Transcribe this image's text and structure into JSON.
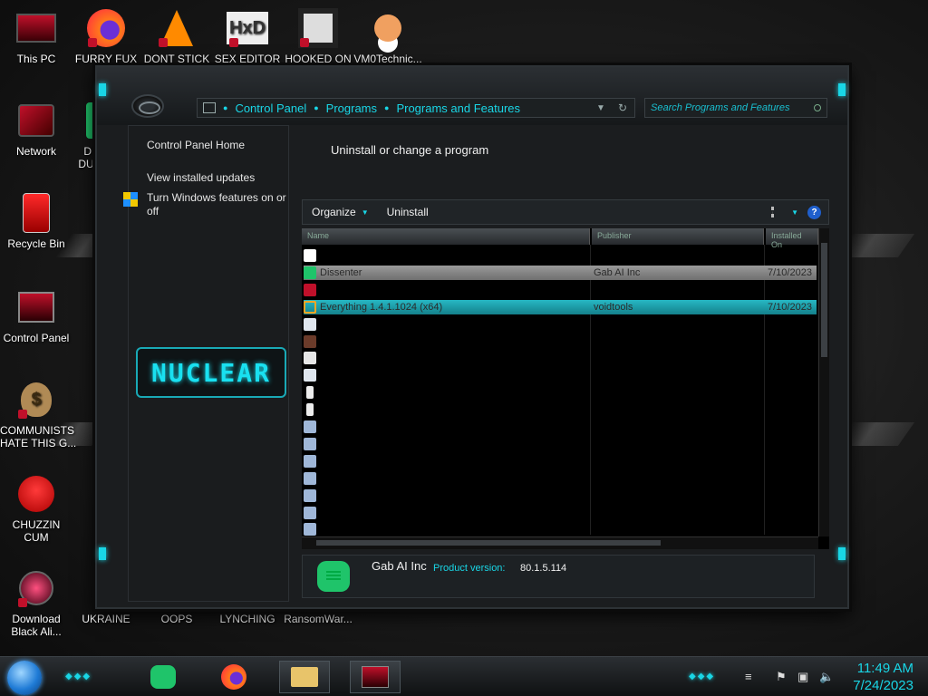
{
  "desktop": {
    "icons": [
      {
        "label": "This PC"
      },
      {
        "label": "FURRY FUX"
      },
      {
        "label": "DONT STICK"
      },
      {
        "label": "SEX EDITOR"
      },
      {
        "label": "HOOKED ON"
      },
      {
        "label": "VM0Technic..."
      },
      {
        "label": "Network"
      },
      {
        "label": "D I\nDUM"
      },
      {
        "label": "Recycle Bin"
      },
      {
        "label": "Control Panel"
      },
      {
        "label": "COMMUNISTS\nHATE THIS G..."
      },
      {
        "label": "CHUZZIN\nCUM"
      },
      {
        "label": "Download\nBlack Ali..."
      },
      {
        "label": "UKRAINE"
      },
      {
        "label": "OOPS"
      },
      {
        "label": "LYNCHING"
      },
      {
        "label": "RansomWar..."
      }
    ]
  },
  "window": {
    "breadcrumb": [
      "Control Panel",
      "Programs",
      "Programs and Features"
    ],
    "search_placeholder": "Search Programs and Features",
    "nav": {
      "home": "Control Panel Home",
      "updates": "View installed updates",
      "features": "Turn Windows features on or off"
    },
    "brand": "NUCLEAR",
    "heading": "Uninstall or change a program",
    "toolbar": {
      "organize": "Organize",
      "uninstall": "Uninstall",
      "help": "?"
    },
    "columns": [
      "Name",
      "Publisher",
      "Installed On"
    ],
    "rows": [
      {
        "icon": "7zip-icon",
        "name": "",
        "publisher": "",
        "date": ""
      },
      {
        "icon": "dissenter-icon",
        "name": "Dissenter",
        "publisher": "Gab AI Inc",
        "date": "7/10/2023",
        "state": "selected-grey"
      },
      {
        "icon": "devc-icon",
        "name": "",
        "publisher": "",
        "date": ""
      },
      {
        "icon": "everything-icon",
        "name": "Everything 1.4.1.1024 (x64)",
        "publisher": "voidtools",
        "date": "7/10/2023",
        "state": "selected-cyan"
      },
      {
        "icon": "window-icon",
        "name": "",
        "publisher": "",
        "date": ""
      },
      {
        "icon": "portrait-icon",
        "name": "",
        "publisher": "",
        "date": ""
      },
      {
        "icon": "java-icon",
        "name": "",
        "publisher": "",
        "date": ""
      },
      {
        "icon": "window-icon",
        "name": "",
        "publisher": "",
        "date": ""
      },
      {
        "icon": "document-icon",
        "name": "",
        "publisher": "",
        "date": ""
      },
      {
        "icon": "document-icon",
        "name": "",
        "publisher": "",
        "date": ""
      },
      {
        "icon": "vcredist-icon",
        "name": "",
        "publisher": "",
        "date": ""
      },
      {
        "icon": "vcredist-icon",
        "name": "",
        "publisher": "",
        "date": ""
      },
      {
        "icon": "vcredist-icon",
        "name": "",
        "publisher": "",
        "date": ""
      },
      {
        "icon": "vcredist-icon",
        "name": "",
        "publisher": "",
        "date": ""
      },
      {
        "icon": "vcredist-icon",
        "name": "",
        "publisher": "",
        "date": ""
      },
      {
        "icon": "vcredist-icon",
        "name": "",
        "publisher": "",
        "date": ""
      },
      {
        "icon": "vcredist-icon",
        "name": "",
        "publisher": "",
        "date": ""
      }
    ],
    "details": {
      "publisher": "Gab AI Inc",
      "version_label": "Product version:",
      "version": "80.1.5.114"
    }
  },
  "taskbar": {
    "time": "11:49 AM",
    "date": "7/24/2023"
  },
  "colors": {
    "accent": "#19d6e6",
    "selection_cyan": "#27b8c4",
    "selection_grey": "#8a8a8a"
  }
}
